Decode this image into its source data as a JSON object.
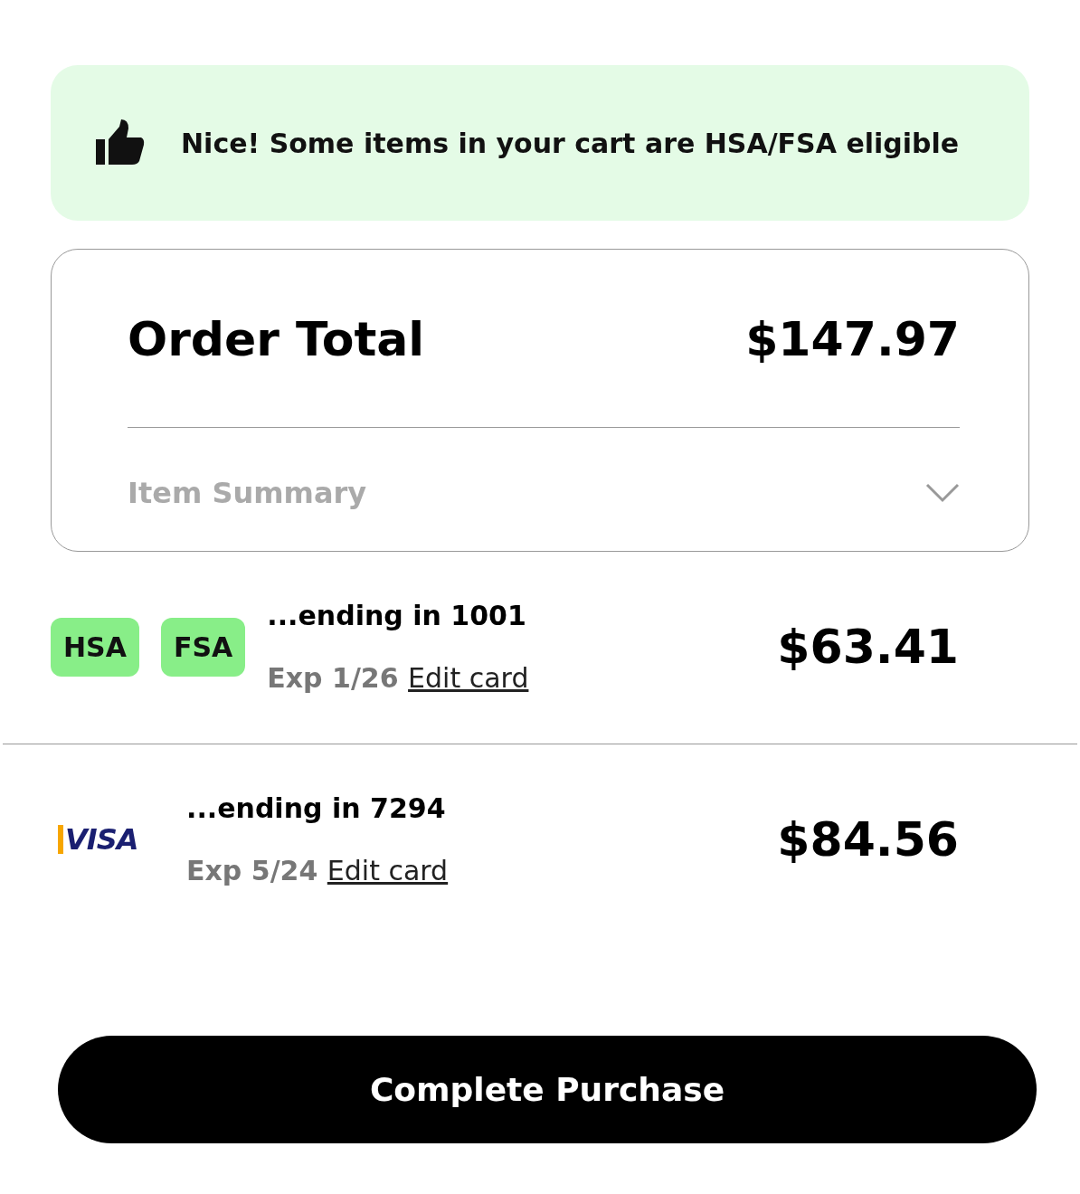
{
  "banner": {
    "text": "Nice! Some items in your cart are HSA/FSA eligible"
  },
  "order_total": {
    "label": "Order Total",
    "amount": "$147.97"
  },
  "item_summary": {
    "label": "Item Summary",
    "expanded": false
  },
  "payments": [
    {
      "kind": "badges",
      "badges": [
        "HSA",
        "FSA"
      ],
      "ending": "...ending in 1001",
      "exp": "Exp 1/26",
      "edit": "Edit card",
      "amount": "$63.41"
    },
    {
      "kind": "visa",
      "logo": "VISA",
      "ending": "...ending in 7294",
      "exp": "Exp 5/24",
      "edit": "Edit card",
      "amount": "$84.56"
    }
  ],
  "button": "Complete Purchase"
}
